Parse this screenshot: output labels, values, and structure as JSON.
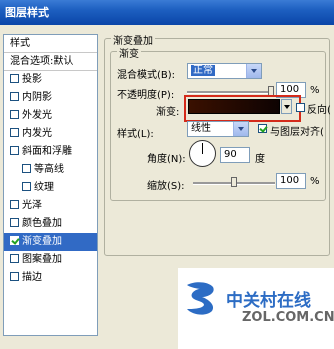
{
  "window": {
    "title": "图层样式"
  },
  "styles_panel": {
    "header": "样式",
    "blend_options": "混合选项:默认",
    "items": [
      {
        "label": "投影",
        "checked": false,
        "indent": false,
        "selected": false
      },
      {
        "label": "内阴影",
        "checked": false,
        "indent": false,
        "selected": false
      },
      {
        "label": "外发光",
        "checked": false,
        "indent": false,
        "selected": false
      },
      {
        "label": "内发光",
        "checked": false,
        "indent": false,
        "selected": false
      },
      {
        "label": "斜面和浮雕",
        "checked": false,
        "indent": false,
        "selected": false
      },
      {
        "label": "等高线",
        "checked": false,
        "indent": true,
        "selected": false
      },
      {
        "label": "纹理",
        "checked": false,
        "indent": true,
        "selected": false
      },
      {
        "label": "光泽",
        "checked": false,
        "indent": false,
        "selected": false
      },
      {
        "label": "颜色叠加",
        "checked": false,
        "indent": false,
        "selected": false
      },
      {
        "label": "渐变叠加",
        "checked": true,
        "indent": false,
        "selected": true
      },
      {
        "label": "图案叠加",
        "checked": false,
        "indent": false,
        "selected": false
      },
      {
        "label": "描边",
        "checked": false,
        "indent": false,
        "selected": false
      }
    ]
  },
  "gradient_overlay": {
    "group_title": "渐变叠加",
    "subgroup_title": "渐变",
    "blend_mode": {
      "label": "混合模式(B):",
      "value": "正常"
    },
    "opacity": {
      "label": "不透明度(P):",
      "value": "100",
      "unit": "%",
      "level": 1.0
    },
    "gradient": {
      "label": "渐变:",
      "reverse_label": "反向(",
      "reverse_checked": false,
      "colors": [
        "#3a1000",
        "#0e0302"
      ]
    },
    "style": {
      "label": "样式(L):",
      "value": "线性",
      "align_label": "与图层对齐(",
      "align_checked": true
    },
    "angle": {
      "label": "角度(N):",
      "value": "90",
      "unit": "度"
    },
    "scale": {
      "label": "缩放(S):",
      "value": "100",
      "unit": "%",
      "level": 0.5
    }
  },
  "watermark": {
    "cn": "中关村在线",
    "en": "ZOL.COM.CN"
  }
}
